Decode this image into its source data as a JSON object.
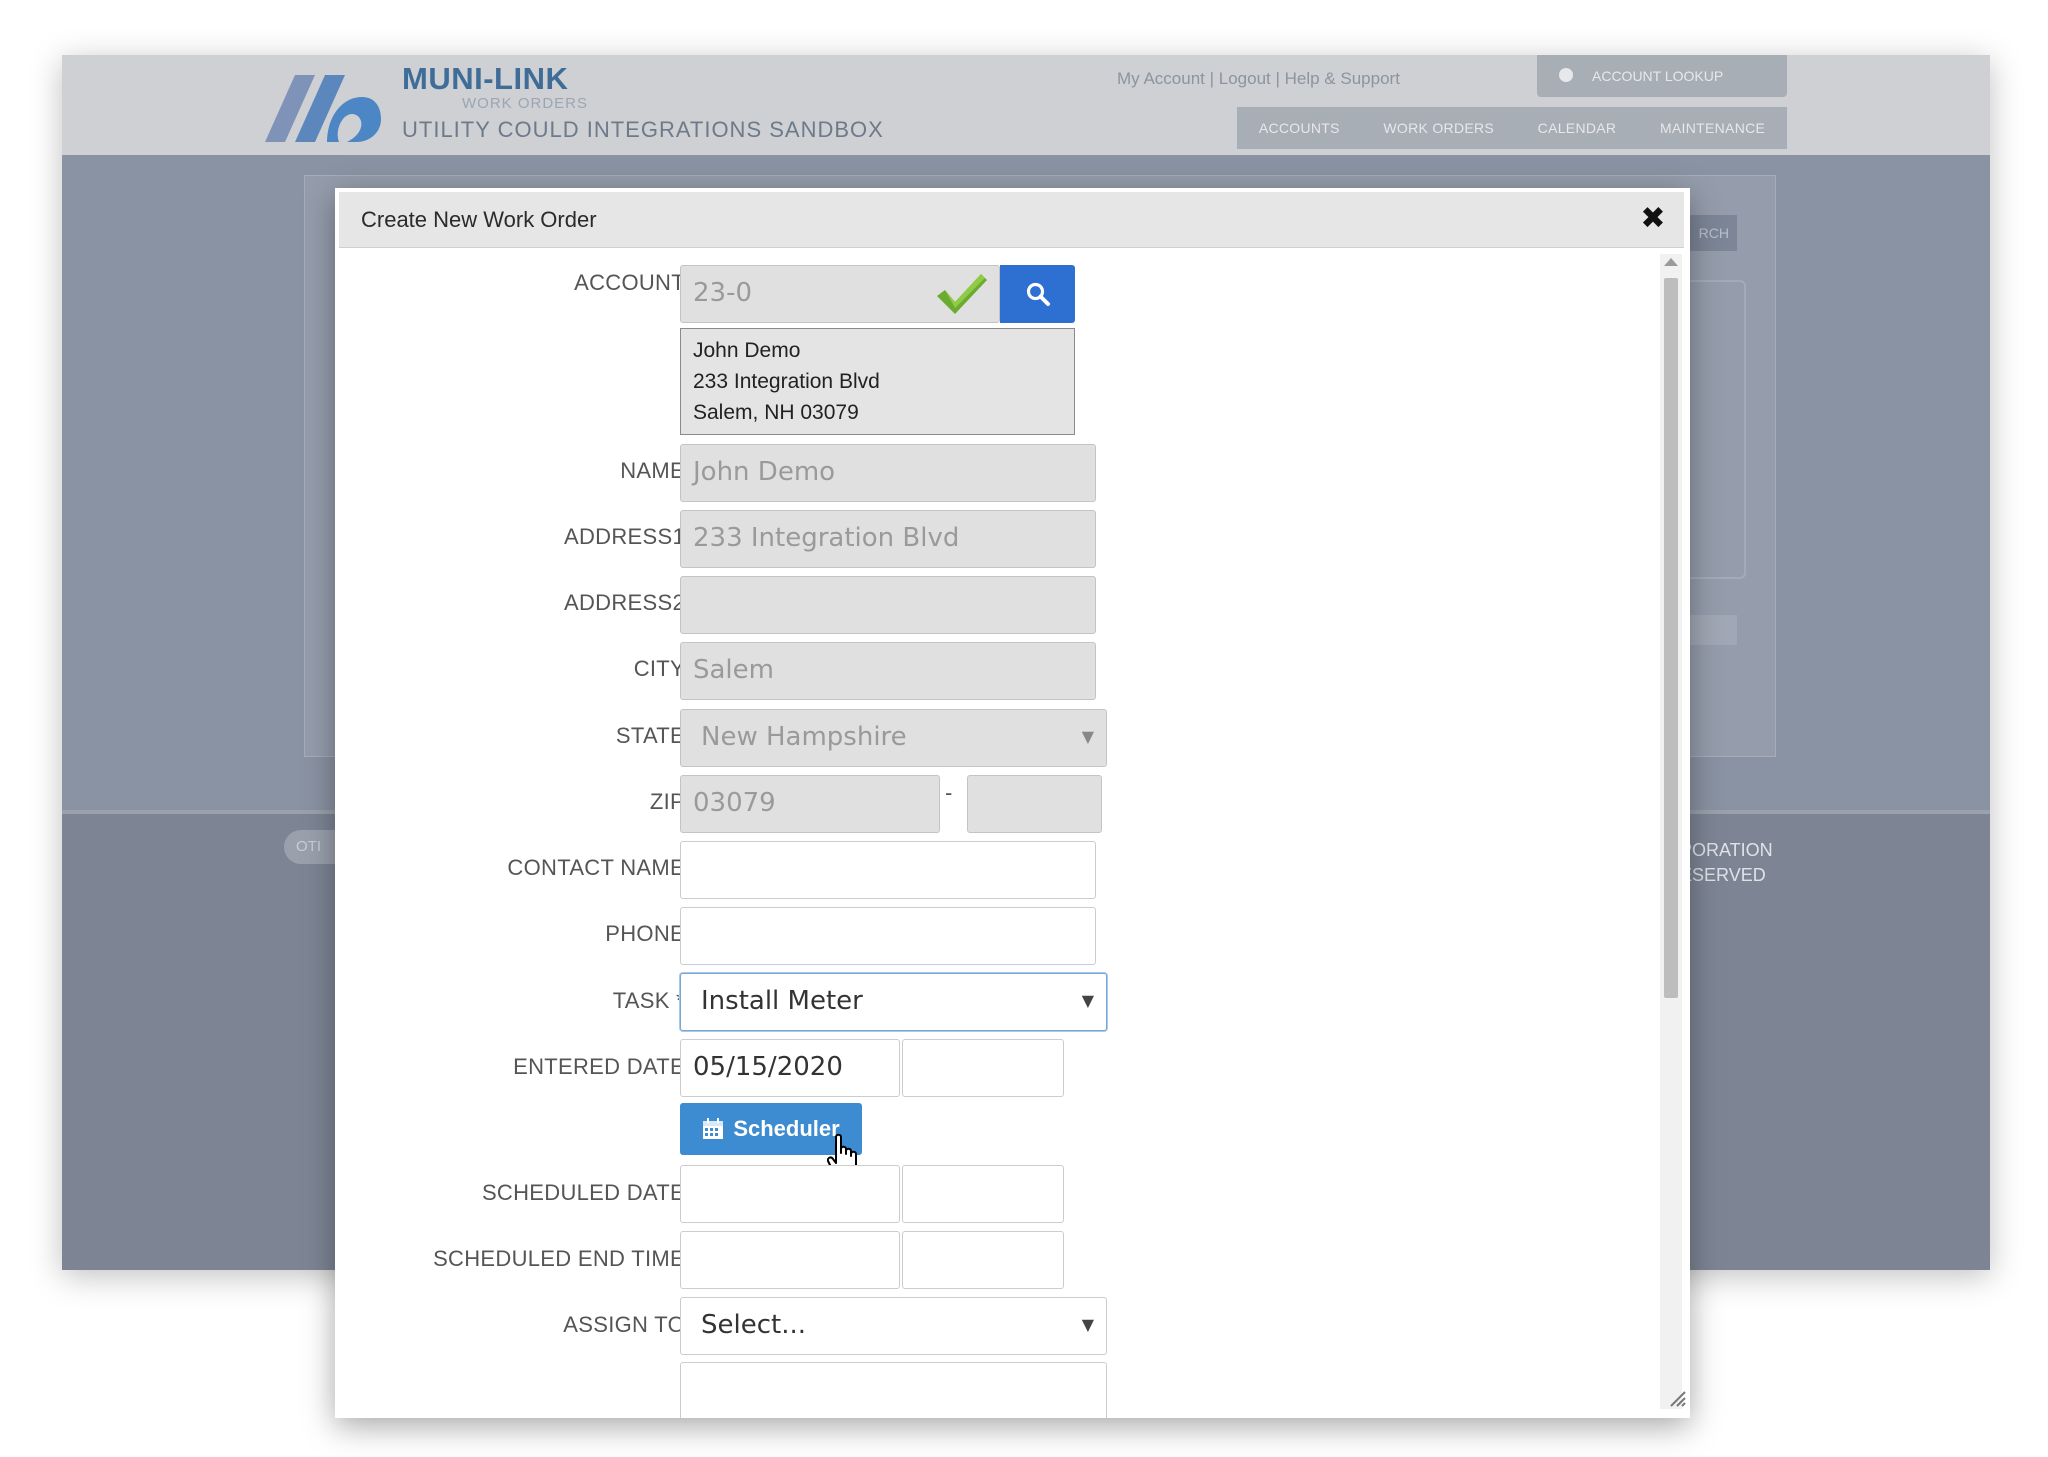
{
  "app": {
    "brand_name": "MUNI-LINK",
    "brand_sub": "WORK ORDERS",
    "sandbox_title": "UTILITY COULD INTEGRATIONS SANDBOX",
    "top_links": {
      "my_account": "My Account",
      "logout": "Logout",
      "help": "Help & Support",
      "separator": " | "
    },
    "account_lookup_label": "ACCOUNT LOOKUP",
    "nav": [
      "ACCOUNTS",
      "WORK ORDERS",
      "CALENDAR",
      "MAINTENANCE"
    ],
    "bg_search_fragment": "RCH",
    "footer_pill_fragment": "OTI",
    "footer_copy_line1": "PORATION",
    "footer_copy_line2": "ESERVED"
  },
  "modal": {
    "title": "Create New Work Order",
    "close_glyph": "✖",
    "labels": {
      "account": "ACCOUNT",
      "name": "NAME",
      "address1": "ADDRESS1",
      "address2": "ADDRESS2",
      "city": "CITY",
      "state": "STATE",
      "zip": "ZIP",
      "contact_name": "CONTACT NAME",
      "phone": "PHONE",
      "task": "TASK *",
      "entered_date": "ENTERED DATE",
      "scheduled_date": "SCHEDULED DATE",
      "scheduled_end_time": "SCHEDULED END TIME",
      "assign_to": "ASSIGN TO"
    },
    "values": {
      "account": "23-0",
      "account_info": [
        "John Demo",
        "233 Integration Blvd",
        "Salem, NH 03079"
      ],
      "name": "John Demo",
      "address1": "233 Integration Blvd",
      "address2": "",
      "city": "Salem",
      "state": "New Hampshire",
      "zip": "03079",
      "zip_ext": "",
      "contact_name": "",
      "phone": "",
      "task": "Install Meter",
      "entered_date": "05/15/2020",
      "entered_time": "",
      "scheduled_date": "",
      "scheduled_time": "",
      "scheduled_end_date": "",
      "scheduled_end_time": "",
      "assign_to": "Select...",
      "zip_separator": "-"
    },
    "scheduler_label": "Scheduler"
  },
  "colors": {
    "primary_button": "#2e6fd2",
    "scheduler_button": "#3d8bd1",
    "check_green": "#6cab2f",
    "brand_blue": "#3f6d98"
  },
  "icons": {
    "account_valid": "check-icon",
    "account_search": "search-icon",
    "scheduler": "calendar-icon",
    "close": "close-icon"
  }
}
